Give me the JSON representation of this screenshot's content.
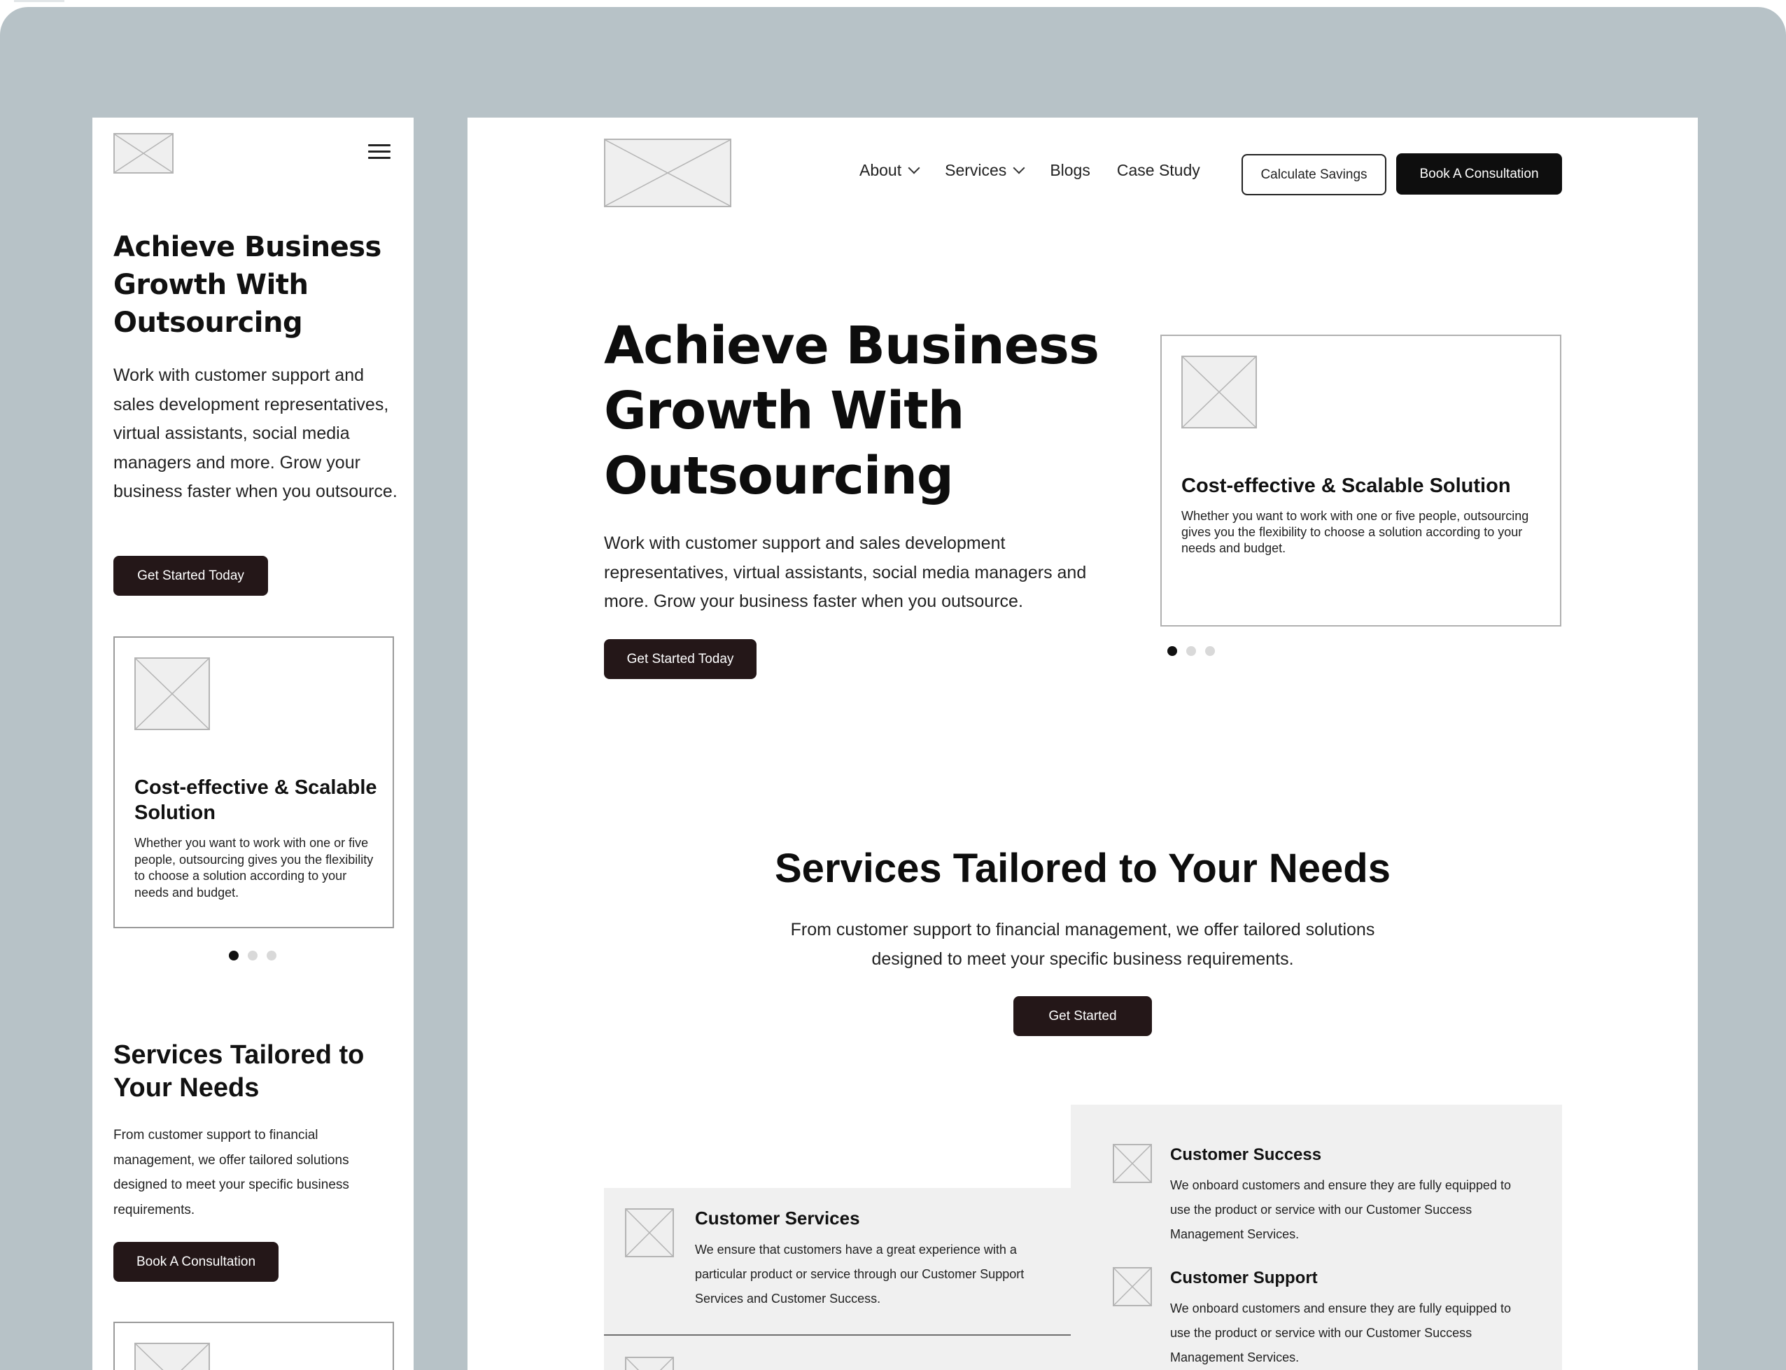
{
  "mobile": {
    "hero": {
      "title": "Achieve Business Growth With Outsourcing",
      "description": "Work with customer support and sales development representatives, virtual assistants, social media managers and more. Grow your business faster when you outsource.",
      "cta_label": "Get Started Today"
    },
    "card": {
      "title": "Cost-effective & Scalable Solution",
      "text": "Whether you want to work with one or five people, outsourcing gives you the flexibility to choose a solution according to your needs and budget."
    },
    "services": {
      "title": "Services Tailored to Your Needs",
      "description": "From customer support to financial management, we offer tailored solutions designed to meet your specific business requirements.",
      "cta_label": "Book A Consultation"
    }
  },
  "desktop": {
    "nav": {
      "items": [
        {
          "label": "About",
          "has_dropdown": true
        },
        {
          "label": "Services",
          "has_dropdown": true
        },
        {
          "label": "Blogs",
          "has_dropdown": false
        },
        {
          "label": "Case Study",
          "has_dropdown": false
        }
      ],
      "secondary_button": "Calculate Savings",
      "primary_button": "Book A Consultation"
    },
    "hero": {
      "title": "Achieve Business Growth With Outsourcing",
      "description": "Work with customer support and sales development representatives, virtual assistants, social media managers and more. Grow your business faster when you outsource.",
      "cta_label": "Get Started Today"
    },
    "card": {
      "title": "Cost-effective & Scalable Solution",
      "text": "Whether you want to work with one or five people, outsourcing gives you the flexibility to choose a solution according to your needs and budget."
    },
    "services": {
      "title": "Services Tailored to Your Needs",
      "description": "From customer support to financial management, we offer tailored solutions designed to meet your specific business requirements.",
      "cta_label": "Get Started",
      "items": [
        {
          "name": "Customer Services",
          "text": "We ensure that customers have a great experience with a particular product or service through our Customer Support Services and Customer Success."
        },
        {
          "name": "Customer Success",
          "text": "We onboard customers and ensure they are fully equipped to use the product or service with our Customer Success Management Services."
        },
        {
          "name": "Customer Support",
          "text": "We onboard customers and ensure they are fully equipped to use the product or service with our Customer Success Management Services."
        }
      ]
    }
  },
  "carousel": {
    "slides": 3,
    "active": 1
  },
  "colors": {
    "backdrop": "#b7c2c7",
    "button_dark": "#241718",
    "button_black": "#0e0e0e",
    "service_panel": "#f0f0f0"
  }
}
